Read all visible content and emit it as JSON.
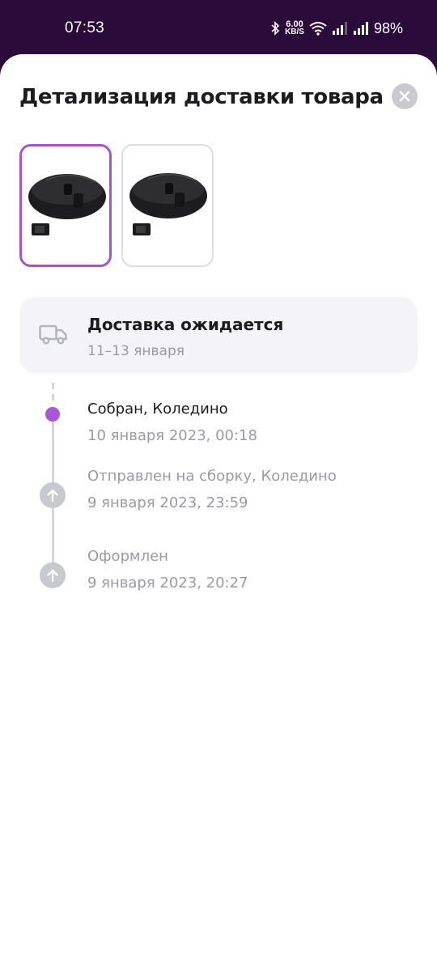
{
  "status_bar": {
    "time": "07:53",
    "network_speed_value": "6.00",
    "network_speed_unit": "KB/S",
    "battery": "98%",
    "icons": [
      "bluetooth-icon",
      "wifi-icon",
      "signal-icon",
      "signal-icon"
    ]
  },
  "sheet": {
    "title": "Детализация доставки товара",
    "close_icon": "close-icon"
  },
  "products": [
    {
      "name": "mouse-thumbnail-1",
      "selected": true
    },
    {
      "name": "mouse-thumbnail-2",
      "selected": false
    }
  ],
  "delivery": {
    "icon": "truck-icon",
    "status": "Доставка ожидается",
    "date": "11–13 января"
  },
  "timeline": [
    {
      "title": "Собран, Коледино",
      "date": "10 января 2023, 00:18",
      "state": "current"
    },
    {
      "title": "Отправлен на сборку, Коледино",
      "date": "9 января 2023, 23:59",
      "state": "past"
    },
    {
      "title": "Оформлен",
      "date": "9 января 2023, 20:27",
      "state": "past"
    }
  ],
  "colors": {
    "accent": "#a956d8",
    "header_bg": "#2b0b3a",
    "muted_text": "#9a9aa3",
    "card_bg": "#f4f4f8"
  }
}
